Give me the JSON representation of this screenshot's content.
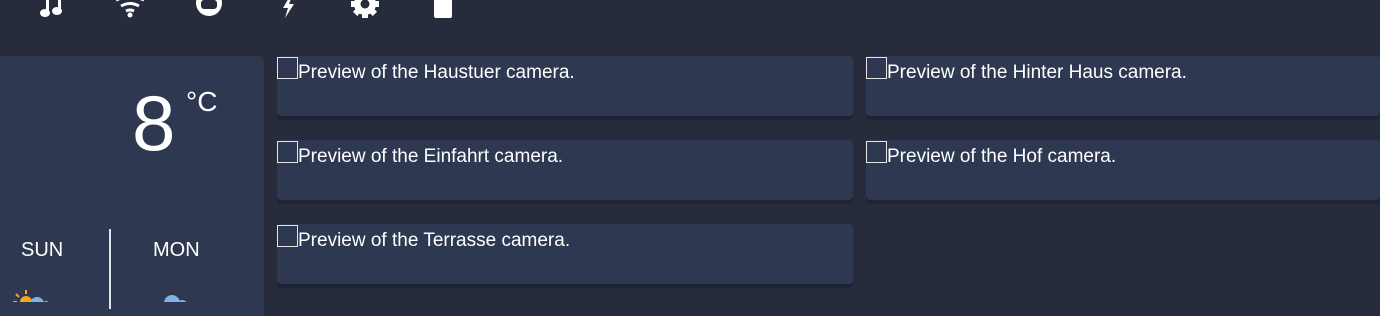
{
  "colors": {
    "background": "#272c3d",
    "card": "#2e3850",
    "text": "#ffffff",
    "sun": "#f5a623",
    "cloud": "#7fb2e5"
  },
  "topbar": {
    "icons": [
      "music-note-icon",
      "wifi-icon",
      "face-icon",
      "lightning-icon",
      "gear-icon",
      "battery-icon"
    ]
  },
  "weather": {
    "temperature": "8",
    "unit": "°C",
    "days": [
      {
        "label": "SUN",
        "icon": "partly-sunny-icon"
      },
      {
        "label": "MON",
        "icon": "cloud-icon"
      }
    ]
  },
  "cameras": [
    {
      "name": "Haustuer",
      "caption": "Preview of the Haustuer camera."
    },
    {
      "name": "Hinter Haus",
      "caption": "Preview of the Hinter Haus camera."
    },
    {
      "name": "Einfahrt",
      "caption": "Preview of the Einfahrt camera."
    },
    {
      "name": "Hof",
      "caption": "Preview of the Hof camera."
    },
    {
      "name": "Terrasse",
      "caption": "Preview of the Terrasse camera."
    }
  ]
}
